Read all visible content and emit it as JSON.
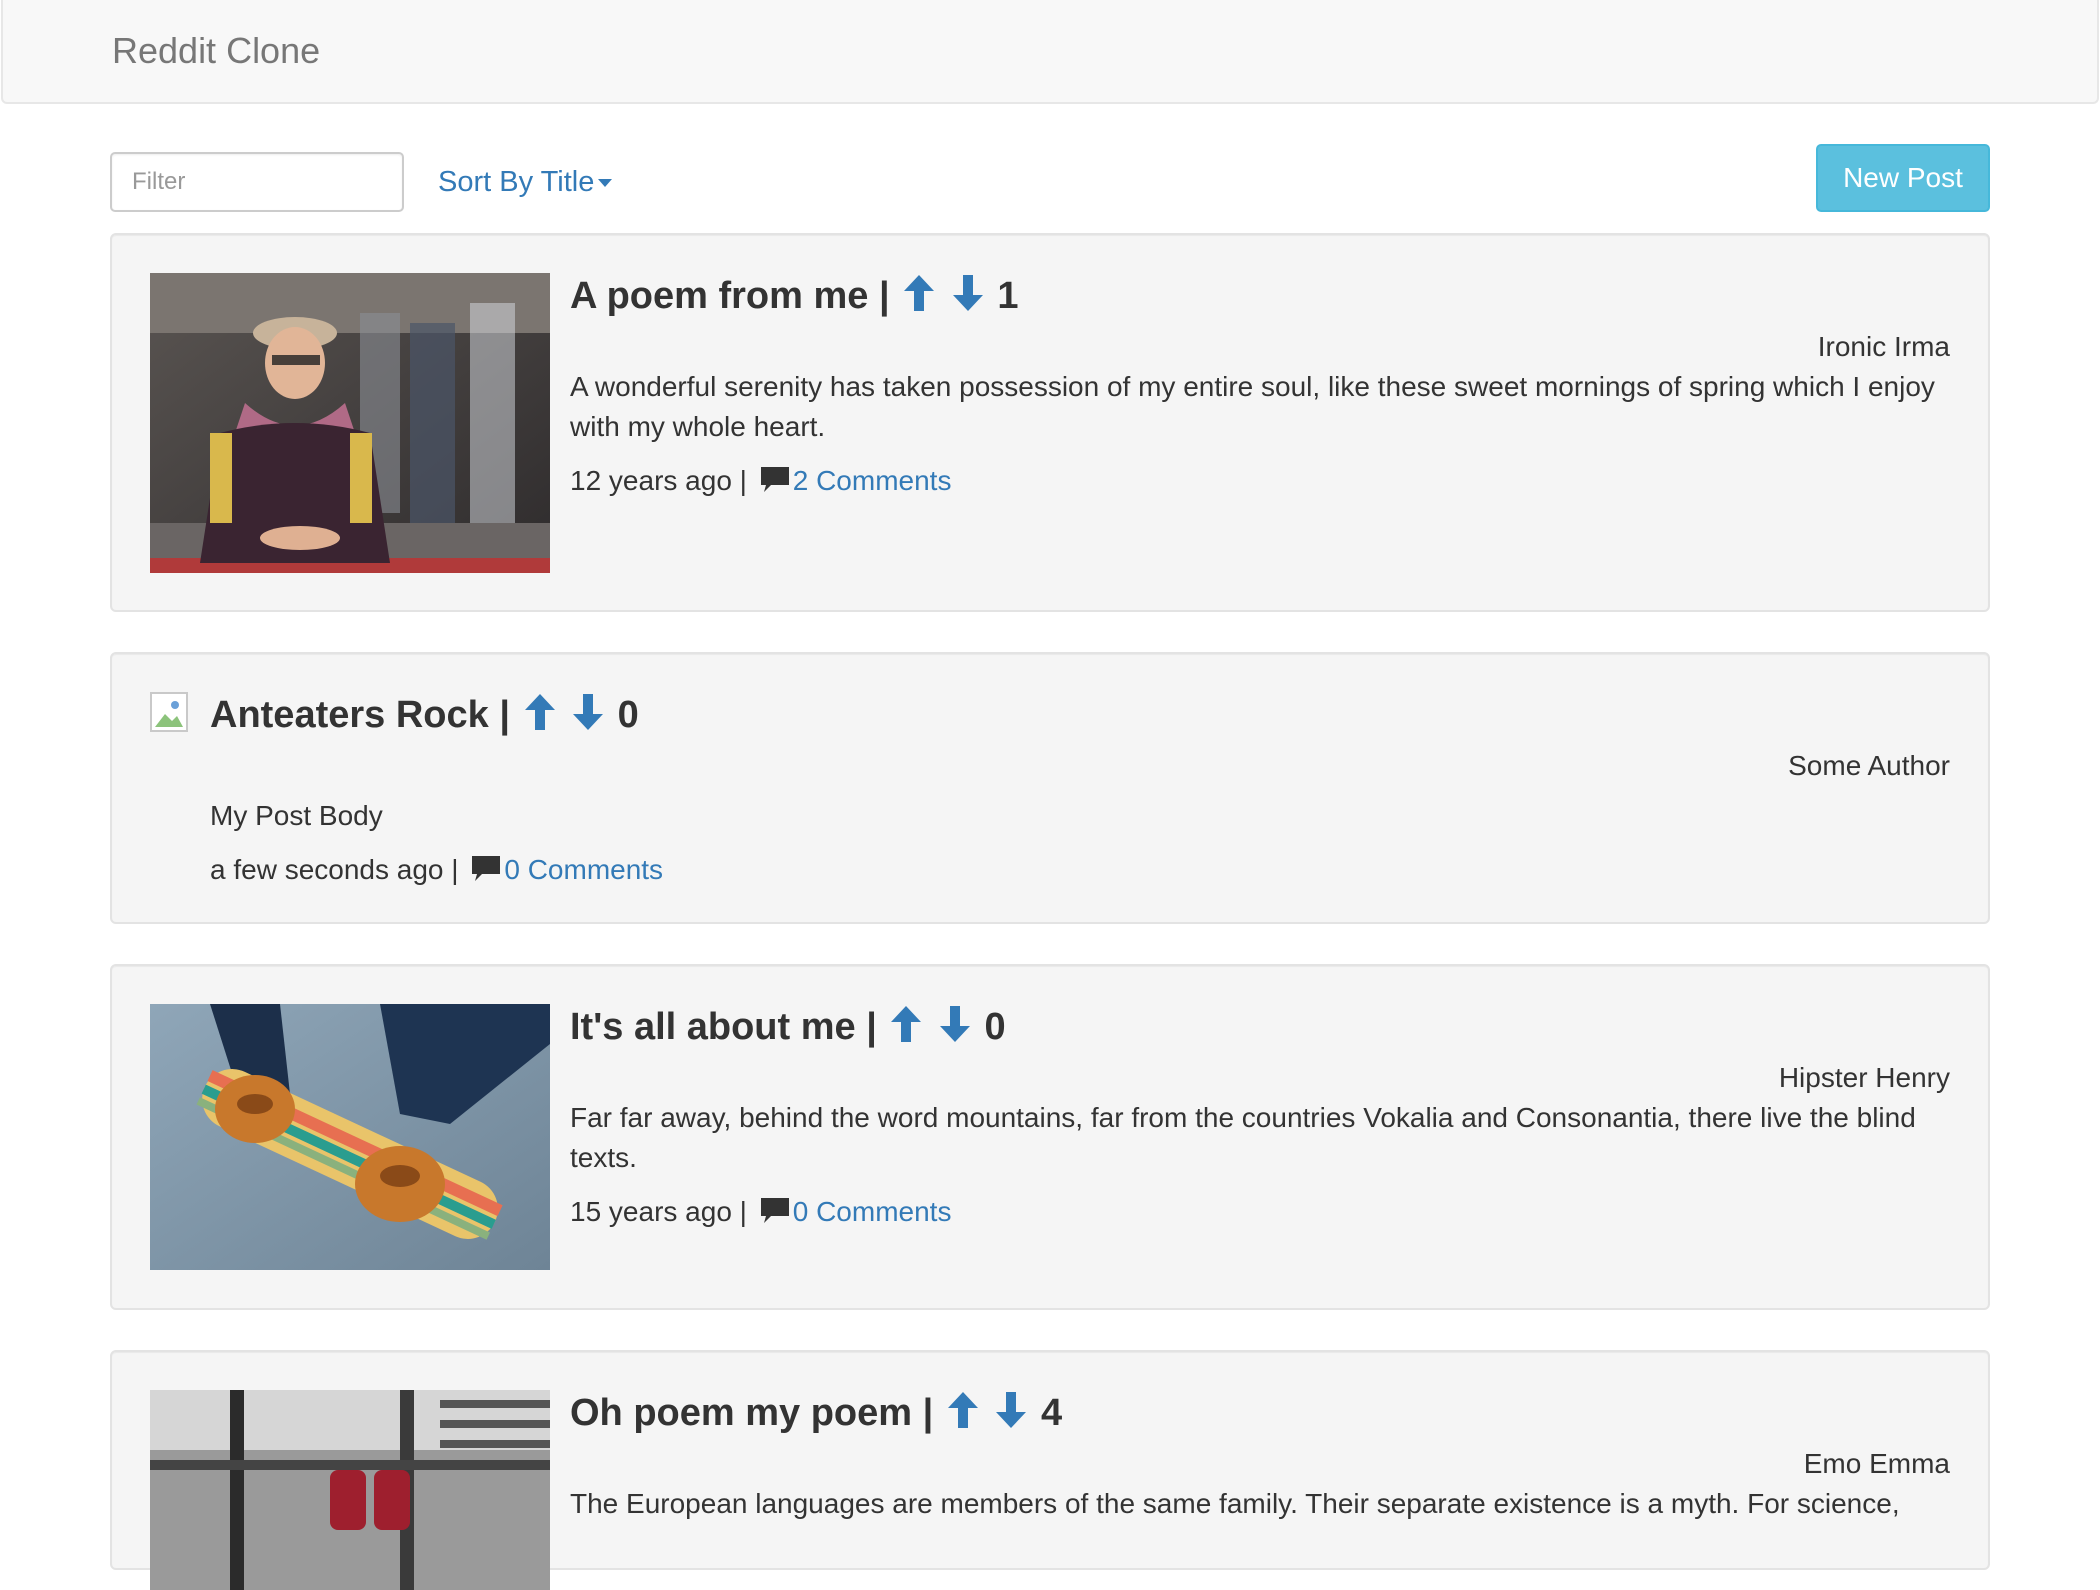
{
  "app": {
    "brand": "Reddit Clone"
  },
  "toolbar": {
    "filter_placeholder": "Filter",
    "sort_label": "Sort By Title",
    "new_post_label": "New Post"
  },
  "posts": [
    {
      "title": "A poem from me",
      "separator": "|",
      "votes": "1",
      "author": "Ironic Irma",
      "body": "A wonderful serenity has taken possession of my entire soul, like these sweet mornings of spring which I enjoy with my whole heart.",
      "time": "12 years ago",
      "meta_separator": "|",
      "comments": "2 Comments",
      "image": "photo-man-with-hat-and-glasses"
    },
    {
      "title": "Anteaters Rock",
      "separator": "|",
      "votes": "0",
      "author": "Some Author",
      "body": "My Post Body",
      "time": "a few seconds ago",
      "meta_separator": "|",
      "comments": "0 Comments",
      "image": "broken-image-icon"
    },
    {
      "title": "It's all about me",
      "separator": "|",
      "votes": "0",
      "author": "Hipster Henry",
      "body": "Far far away, behind the word mountains, far from the countries Vokalia and Consonantia, there live the blind texts.",
      "time": "15 years ago",
      "meta_separator": "|",
      "comments": "0 Comments",
      "image": "photo-shoes-on-skateboard"
    },
    {
      "title": "Oh poem my poem",
      "separator": "|",
      "votes": "4",
      "author": "Emo Emma",
      "body": "The European languages are members of the same family. Their separate existence is a myth. For science,",
      "image": "photo-red-shoes-on-bench"
    }
  ],
  "colors": {
    "link": "#337ab7",
    "button": "#5bc0de",
    "panel": "#f5f5f5"
  },
  "icons": {
    "upvote": "arrow-up-icon",
    "downvote": "arrow-down-icon",
    "comment": "comment-icon"
  }
}
